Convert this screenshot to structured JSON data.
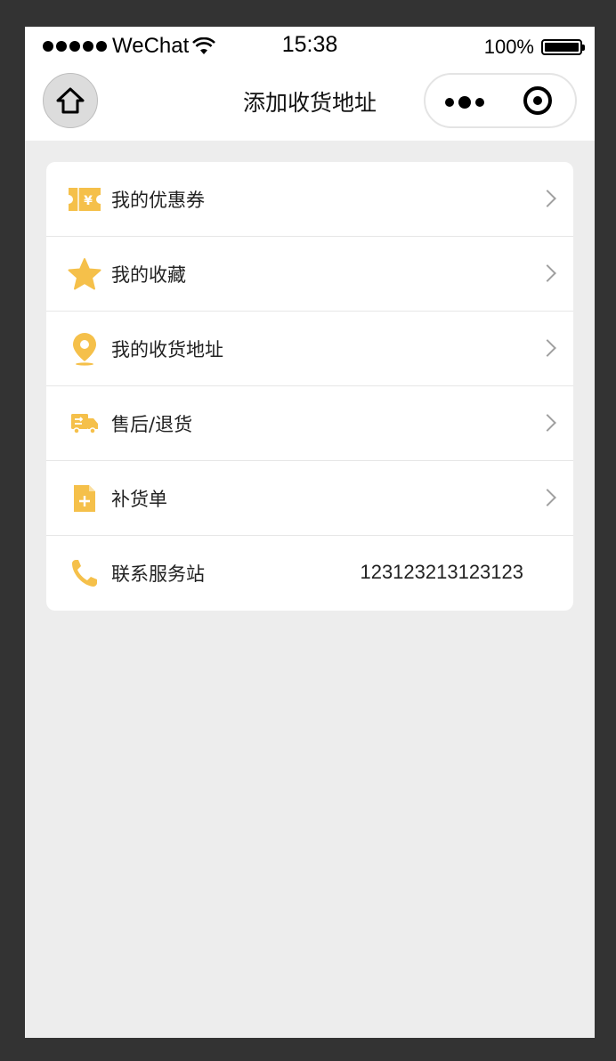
{
  "status_bar": {
    "carrier": "WeChat",
    "time": "15:38",
    "battery_text": "100%",
    "battery_level": 1.0
  },
  "nav": {
    "title": "添加收货地址",
    "home_icon": "home-icon",
    "more_icon": "more-dots-icon",
    "close_icon": "target-icon"
  },
  "menu": {
    "accent_color": "#f5c04a",
    "items": [
      {
        "label": "我的优惠券",
        "icon": "coupon-icon"
      },
      {
        "label": "我的收藏",
        "icon": "star-icon"
      },
      {
        "label": "我的收货地址",
        "icon": "location-pin-icon"
      },
      {
        "label": "售后/退货",
        "icon": "truck-icon"
      },
      {
        "label": "补货单",
        "icon": "document-plus-icon"
      },
      {
        "label": "联系服务站",
        "icon": "phone-icon",
        "value": "123123213123123"
      }
    ]
  }
}
